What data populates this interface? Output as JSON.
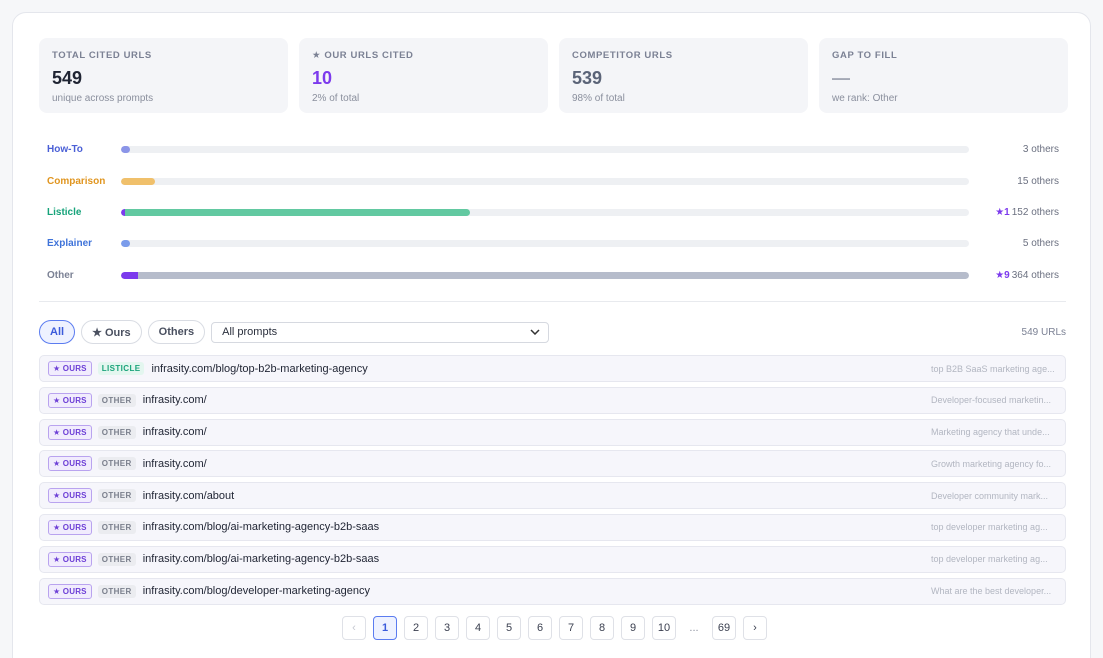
{
  "stats": [
    {
      "label": "Total cited URLs",
      "value": "549",
      "sub": "unique across prompts"
    },
    {
      "label": "★ Our URLs cited",
      "value": "10",
      "sub": "2% of total"
    },
    {
      "label": "Competitor URLs",
      "value": "539",
      "sub": "98% of total"
    },
    {
      "label": "Gap to fill",
      "value": "—",
      "sub": "we rank: Other"
    }
  ],
  "distribution": [
    {
      "name": "How-To",
      "color": "#8b95e8",
      "ours_fraction": 0,
      "others_fraction": 0.0105,
      "ours_label": "",
      "others_label": "3 others"
    },
    {
      "name": "Comparison",
      "color": "#f0c06b",
      "ours_fraction": 0,
      "others_fraction": 0.04,
      "ours_label": "",
      "others_label": "15 others"
    },
    {
      "name": "Listicle",
      "color": "#62c9a1",
      "ours_fraction": 0.003,
      "others_fraction": 0.407,
      "ours_label": "★1",
      "others_label": "152 others"
    },
    {
      "name": "Explainer",
      "color": "#7b9ceb",
      "ours_fraction": 0,
      "others_fraction": 0.0105,
      "ours_label": "",
      "others_label": "5 others"
    },
    {
      "name": "Other",
      "color": "#b6bccb",
      "ours_fraction": 0.02,
      "others_fraction": 0.98,
      "ours_label": "★9",
      "others_label": "364 others"
    }
  ],
  "colors": {
    "ours": "#7c3aed",
    "name_howto": "#4a5fd6",
    "name_comparison": "#e0951f",
    "name_listicle": "#16a37a",
    "name_explainer": "#3f73d9",
    "name_other": "#7b8194"
  },
  "filters": {
    "all": "All",
    "ours": "★ Ours",
    "others": "Others",
    "prompt_select": "All prompts",
    "url_count": "549 URLs"
  },
  "rows": [
    {
      "ours": "★ OURS",
      "type": "LISTICLE",
      "url": "infrasity.com/blog/top-b2b-marketing-agency",
      "prompt": "top B2B SaaS marketing age..."
    },
    {
      "ours": "★ OURS",
      "type": "OTHER",
      "url": "infrasity.com/",
      "prompt": "Developer-focused marketin..."
    },
    {
      "ours": "★ OURS",
      "type": "OTHER",
      "url": "infrasity.com/",
      "prompt": "Marketing agency that unde..."
    },
    {
      "ours": "★ OURS",
      "type": "OTHER",
      "url": "infrasity.com/",
      "prompt": "Growth marketing agency fo..."
    },
    {
      "ours": "★ OURS",
      "type": "OTHER",
      "url": "infrasity.com/about",
      "prompt": "Developer community mark..."
    },
    {
      "ours": "★ OURS",
      "type": "OTHER",
      "url": "infrasity.com/blog/ai-marketing-agency-b2b-saas",
      "prompt": "top developer marketing ag..."
    },
    {
      "ours": "★ OURS",
      "type": "OTHER",
      "url": "infrasity.com/blog/ai-marketing-agency-b2b-saas",
      "prompt": "top developer marketing ag..."
    },
    {
      "ours": "★ OURS",
      "type": "OTHER",
      "url": "infrasity.com/blog/developer-marketing-agency",
      "prompt": "What are the best developer..."
    }
  ],
  "pagination": {
    "prev": "‹",
    "pages": [
      "1",
      "2",
      "3",
      "4",
      "5",
      "6",
      "7",
      "8",
      "9",
      "10"
    ],
    "active": "1",
    "ellipsis": "...",
    "last": "69",
    "next": "›"
  }
}
